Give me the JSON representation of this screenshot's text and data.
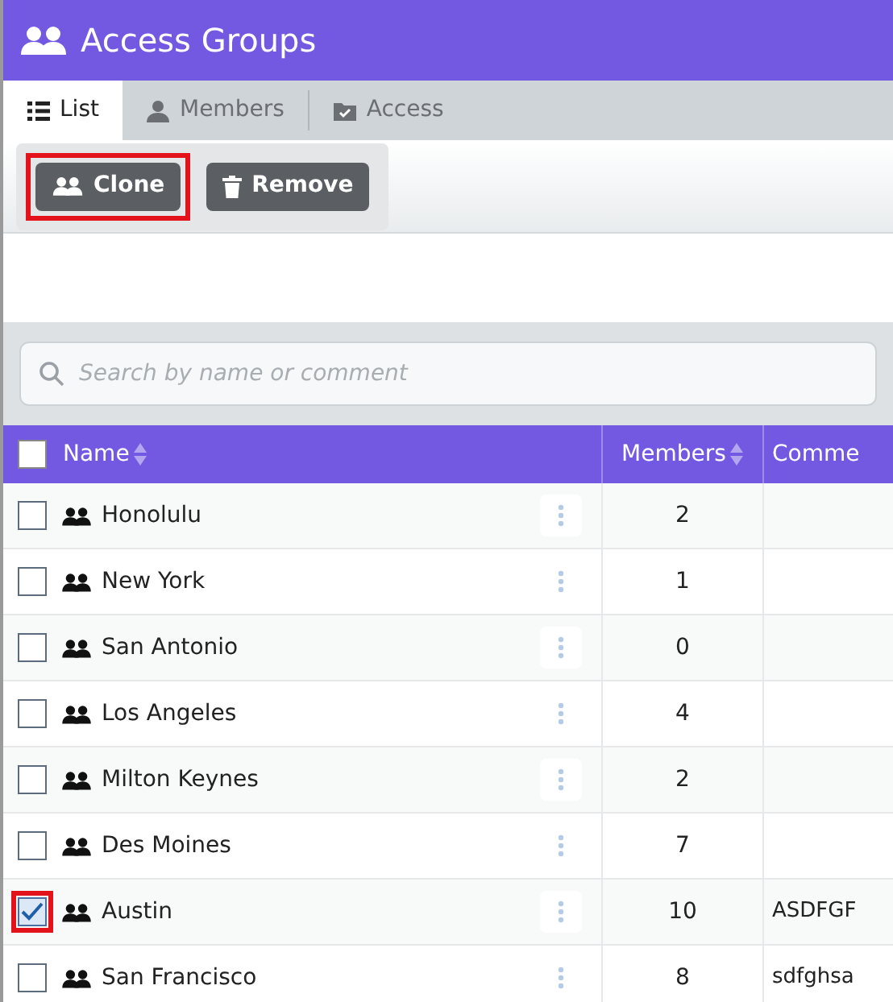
{
  "header": {
    "title": "Access Groups"
  },
  "tabs": [
    {
      "label": "List",
      "selected": true
    },
    {
      "label": "Members",
      "selected": false
    },
    {
      "label": "Access",
      "selected": false
    }
  ],
  "toolbar": [
    {
      "kind": "clone",
      "label": "Clone",
      "highlighted": true
    },
    {
      "kind": "remove",
      "label": "Remove",
      "highlighted": false
    }
  ],
  "search": {
    "placeholder": "Search by name or comment"
  },
  "table": {
    "columns": [
      "Name",
      "Members",
      "Comme"
    ],
    "all_checked": false,
    "rows": [
      {
        "name": "Honolulu",
        "members": "2",
        "comment": "",
        "checked": false,
        "highlighted": false
      },
      {
        "name": "New York",
        "members": "1",
        "comment": "",
        "checked": false,
        "highlighted": false
      },
      {
        "name": "San Antonio",
        "members": "0",
        "comment": "",
        "checked": false,
        "highlighted": false
      },
      {
        "name": "Los Angeles",
        "members": "4",
        "comment": "",
        "checked": false,
        "highlighted": false
      },
      {
        "name": "Milton Keynes",
        "members": "2",
        "comment": "",
        "checked": false,
        "highlighted": false
      },
      {
        "name": "Des Moines",
        "members": "7",
        "comment": "",
        "checked": false,
        "highlighted": false
      },
      {
        "name": "Austin",
        "members": "10",
        "comment": "ASDFGF",
        "checked": true,
        "highlighted": true
      },
      {
        "name": "San Francisco",
        "members": "8",
        "comment": "sdfghsa",
        "checked": false,
        "highlighted": false
      }
    ]
  }
}
